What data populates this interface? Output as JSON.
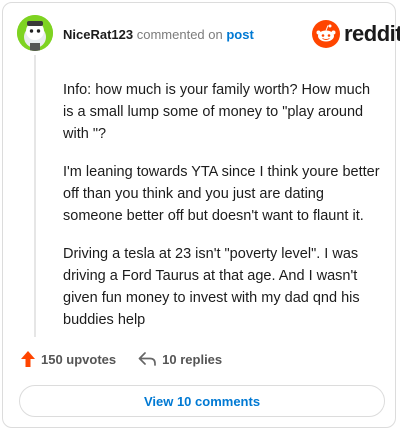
{
  "comment": {
    "username": "NiceRat123",
    "commented_text": "commented on",
    "post_link": "post",
    "paragraphs": [
      "Info: how much is your family worth? How much is a small lump some of money to \"play around with \"?",
      "I'm leaning towards YTA since I think youre better off than you think and you just are dating someone better off but doesn't want to flaunt it.",
      "Driving a tesla at 23 isn't \"poverty level\". I was driving a Ford Taurus at that age. And I wasn't given fun money to invest with my dad qnd his buddies help"
    ]
  },
  "brand": {
    "logo_text": "reddit",
    "color": "#ff4500"
  },
  "actions": {
    "upvotes": "150 upvotes",
    "replies": "10 replies"
  },
  "view_button": {
    "label": "View 10 comments"
  },
  "colors": {
    "accent": "#0079d3",
    "avatar_bg": "#7ed321",
    "upvote": "#ff4500"
  }
}
